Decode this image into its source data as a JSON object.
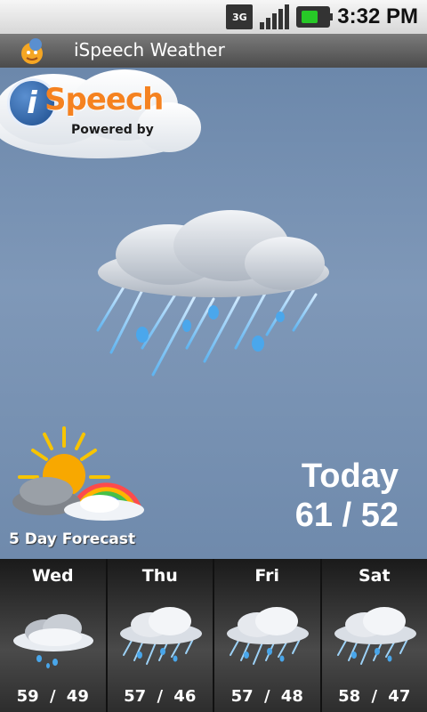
{
  "status_bar": {
    "network": "3G",
    "time": "3:32 PM"
  },
  "app": {
    "title": "iSpeech Weather"
  },
  "logo": {
    "brand_i": "i",
    "brand_text": "Speech",
    "powered_by": "Powered by"
  },
  "current": {
    "condition_icon": "rain-cloud-icon",
    "today_label": "Today",
    "temps": "61 / 52"
  },
  "forecast_link": {
    "label": "5 Day Forecast",
    "icon": "sun-cloud-rainbow-icon"
  },
  "days": [
    {
      "name": "Wed",
      "temps": "59 / 49",
      "icon": "light-rain-cloud-icon"
    },
    {
      "name": "Thu",
      "temps": "57 / 46",
      "icon": "rain-cloud-icon"
    },
    {
      "name": "Fri",
      "temps": "57 / 48",
      "icon": "rain-cloud-icon"
    },
    {
      "name": "Sat",
      "temps": "58 / 47",
      "icon": "rain-cloud-icon"
    }
  ]
}
